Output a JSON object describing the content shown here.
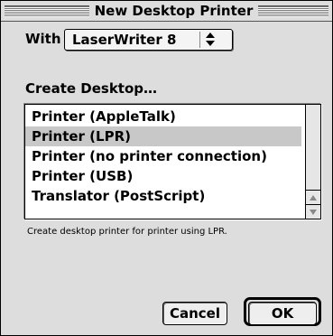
{
  "window": {
    "title": "New Desktop Printer"
  },
  "with_row": {
    "label": "With",
    "popup_value": "LaserWriter 8",
    "popup_icon": "updown-arrows-icon"
  },
  "create_label": "Create Desktop…",
  "list": {
    "items": [
      "Printer (AppleTalk)",
      "Printer (LPR)",
      "Printer (no printer connection)",
      "Printer (USB)",
      "Translator (PostScript)"
    ],
    "selected_index": 1
  },
  "description": "Create desktop printer for printer using LPR.",
  "buttons": {
    "cancel": "Cancel",
    "ok": "OK"
  }
}
